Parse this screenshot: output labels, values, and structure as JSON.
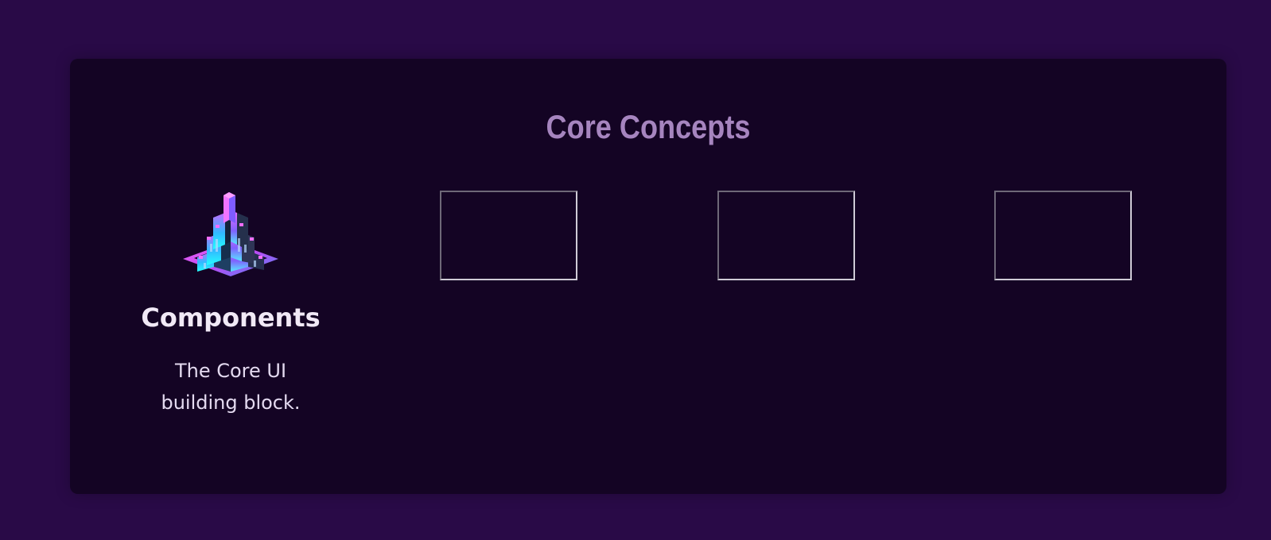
{
  "section": {
    "title": "Core Concepts"
  },
  "concepts": [
    {
      "icon": "components-cube-pyramid-icon",
      "title": "Components",
      "description": "The Core UI building block."
    },
    {
      "image_alt": ""
    },
    {
      "image_alt": ""
    },
    {
      "image_alt": ""
    }
  ],
  "colors": {
    "page_background": "#290a47",
    "card_background": "#140424",
    "title": "#a685bf",
    "heading": "#f1e9f6",
    "body_text": "#e4daf0",
    "accent_pink": "#e85dff",
    "accent_cyan": "#2ff2ff"
  }
}
